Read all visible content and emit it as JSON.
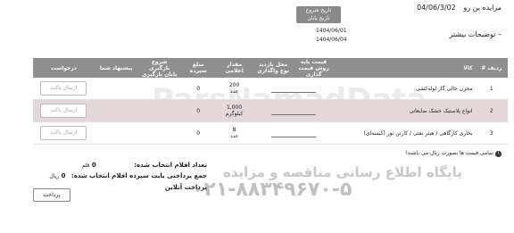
{
  "auction": {
    "label": "مزایده بن رو",
    "end_date": "04/06/3/02",
    "more_label": "توضیحات بیشتر"
  },
  "dates": {
    "start_label": "تاریخ شروع",
    "end_label": "تاریخ پایان",
    "start_value": "1404/06/01",
    "end_value": "1404/06/04"
  },
  "table": {
    "headers": [
      "ردیف #",
      "کالا",
      "قیمت پایه",
      "روش قیمت گذاری",
      "محل بازدید",
      "نوع واگذاری",
      "مقدار اعلامی",
      "مبلغ سپرده",
      "شروع بازگیری",
      "پایان بازگیری",
      "پیشنهاد شما",
      "درخواست"
    ],
    "rows": [
      {
        "index": "1",
        "name": "مخزن خالی گاز لوله‌کشی",
        "qty": "200",
        "unit": "عدد",
        "deposit": "0",
        "action": "ارسال پاکت"
      },
      {
        "index": "2",
        "name": "انواع پلاستیک خشک ضایعاتی",
        "qty": "1,000",
        "unit": "کیلوگرم",
        "deposit": "0",
        "action": "ارسال پاکت"
      },
      {
        "index": "3",
        "name": "بخاری کارگاهی / هیتر نفتی / کارتن نور (کیسه‌ای)",
        "qty": "8",
        "unit": "عدد",
        "deposit": "0",
        "action": "ارسال پاکت"
      }
    ]
  },
  "note": "تمامی قیمت ها بصورت ریال می باشند!",
  "summary": {
    "count_label": "تعداد اقلام انتخاب شده:",
    "count_value": "0",
    "count_unit": "قلم",
    "total_label": "جمع پرداختی بابت سپرده اقلام انتخاب شده:",
    "total_value": "0",
    "total_unit": "ریال",
    "online_label": "پرداخت آنلاین"
  },
  "pay_button": "پرداخت",
  "watermark": {
    "brand": "ParsNamadData",
    "site_line": "پایگاه اطلاع رسانی مناقصه و مزایده",
    "phone": "۰۲۱-۸۸۳۴۹۶۷۰-۵"
  }
}
